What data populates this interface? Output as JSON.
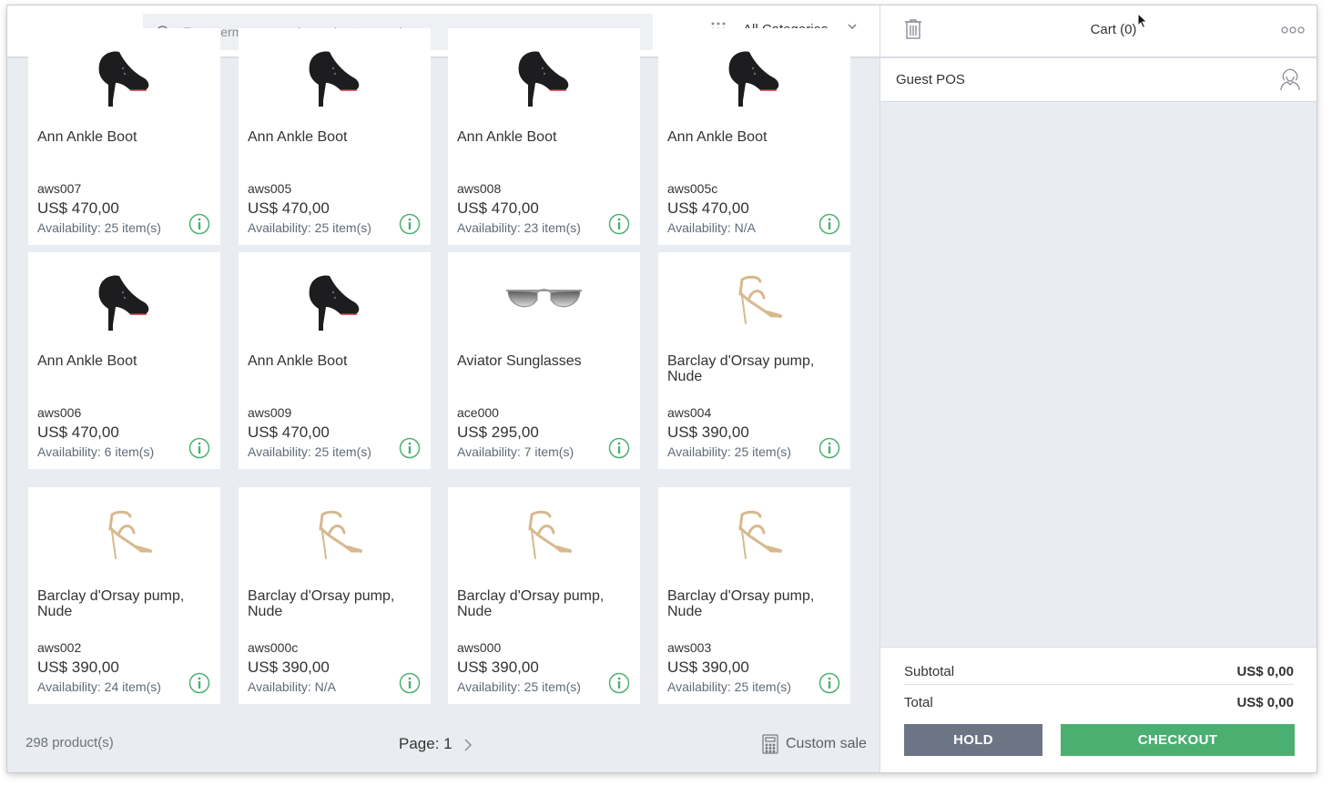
{
  "header": {
    "search_placeholder": "Enter terms or scan barcodes to search",
    "category_label": "All Categories"
  },
  "products": [
    {
      "name": "Ann Ankle Boot",
      "sku": "aws007",
      "price": "US$ 470,00",
      "availability": "Availability: 25 item(s)",
      "image": "boot"
    },
    {
      "name": "Ann Ankle Boot",
      "sku": "aws005",
      "price": "US$ 470,00",
      "availability": "Availability: 25 item(s)",
      "image": "boot"
    },
    {
      "name": "Ann Ankle Boot",
      "sku": "aws008",
      "price": "US$ 470,00",
      "availability": "Availability: 23 item(s)",
      "image": "boot"
    },
    {
      "name": "Ann Ankle Boot",
      "sku": "aws005c",
      "price": "US$ 470,00",
      "availability": "Availability: N/A",
      "image": "boot"
    },
    {
      "name": "Ann Ankle Boot",
      "sku": "aws006",
      "price": "US$ 470,00",
      "availability": "Availability: 6 item(s)",
      "image": "boot"
    },
    {
      "name": "Ann Ankle Boot",
      "sku": "aws009",
      "price": "US$ 470,00",
      "availability": "Availability: 25 item(s)",
      "image": "boot"
    },
    {
      "name": "Aviator Sunglasses",
      "sku": "ace000",
      "price": "US$ 295,00",
      "availability": "Availability: 7 item(s)",
      "image": "sunglasses"
    },
    {
      "name": "Barclay d'Orsay pump, Nude",
      "sku": "aws004",
      "price": "US$ 390,00",
      "availability": "Availability: 25 item(s)",
      "image": "pump"
    },
    {
      "name": "Barclay d'Orsay pump, Nude",
      "sku": "aws002",
      "price": "US$ 390,00",
      "availability": "Availability: 24 item(s)",
      "image": "pump"
    },
    {
      "name": "Barclay d'Orsay pump, Nude",
      "sku": "aws000c",
      "price": "US$ 390,00",
      "availability": "Availability: N/A",
      "image": "pump"
    },
    {
      "name": "Barclay d'Orsay pump, Nude",
      "sku": "aws000",
      "price": "US$ 390,00",
      "availability": "Availability: 25 item(s)",
      "image": "pump"
    },
    {
      "name": "Barclay d'Orsay pump, Nude",
      "sku": "aws003",
      "price": "US$ 390,00",
      "availability": "Availability: 25 item(s)",
      "image": "pump"
    }
  ],
  "footer": {
    "product_count": "298 product(s)",
    "page_label": "Page: 1",
    "custom_sale_label": "Custom sale"
  },
  "cart": {
    "title": "Cart (0)",
    "customer": "Guest POS",
    "subtotal_label": "Subtotal",
    "subtotal_value": "US$ 0,00",
    "total_label": "Total",
    "total_value": "US$ 0,00",
    "hold_label": "HOLD",
    "checkout_label": "CHECKOUT"
  },
  "colors": {
    "accent_green": "#4caf72",
    "hold_gray": "#6d7585",
    "background": "#e9ecf1"
  },
  "icons": [
    "menu-icon",
    "bell-icon",
    "search-icon",
    "grid-icon",
    "chevron-down-icon",
    "info-icon",
    "trash-icon",
    "more-icon",
    "customer-icon",
    "calculator-icon",
    "chevron-right-icon"
  ]
}
